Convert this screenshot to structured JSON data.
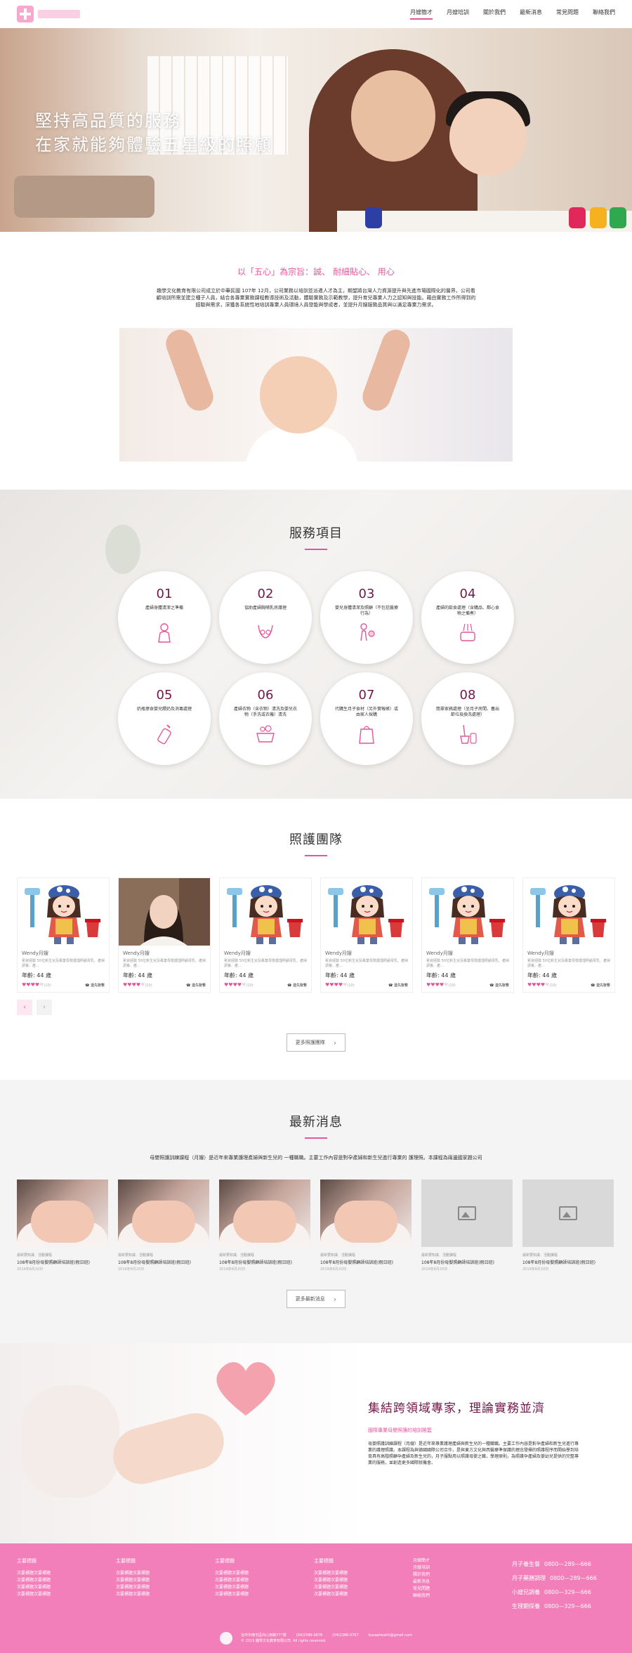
{
  "nav": {
    "items": [
      {
        "label": "月嫂簡才",
        "active": true
      },
      {
        "label": "月嫂培訓",
        "active": false
      },
      {
        "label": "關於我們",
        "active": false
      },
      {
        "label": "最新消息",
        "active": false
      },
      {
        "label": "常見問題",
        "active": false
      },
      {
        "label": "聯絡我們",
        "active": false
      }
    ]
  },
  "hero": {
    "line1": "堅持高品質的服務",
    "line2": "在家就能夠體驗五星級的照顧"
  },
  "intro": {
    "title": "以「五心」為宗旨：誠、 耐細貼心、 用心",
    "body": "趣學文化教育有限公司成立於中華民國 107年 12月，公司業務以培訓並派遣人才為主，期望將台灣人力資源提升與先進市場國際化的層界。公司看顧培訓所需並建立種子人員，結合各專業實務課程教導技術及活動，體驗實務及示範教學，提升育兒專業人力之認知與技能。藉由實務工作所得到的經驗與需求，深獲各系統性地培訓專業人員環境人員發能與學成者，並提升月嫂服務品質與以滿足專業力需求。"
  },
  "services": {
    "title": "服務項目",
    "items": [
      {
        "num": "01",
        "text": "產婦身體清潔之準備",
        "icon": "mother-icon"
      },
      {
        "num": "02",
        "text": "協助產婦胸哺乳房護理",
        "icon": "breast-care-icon"
      },
      {
        "num": "03",
        "text": "嬰兒身體清潔及照顧（不包括醫療行為）",
        "icon": "baby-care-icon"
      },
      {
        "num": "04",
        "text": "產婦的飲食處理（含購品、鄰心食物之備煮）",
        "icon": "food-icon"
      },
      {
        "num": "05",
        "text": "奶瓶擦食嬰兒餵奶及消毒處理",
        "icon": "bottle-icon"
      },
      {
        "num": "06",
        "text": "產婦衣物（含衣物）清洗及嬰兒衣物（手洗或衣機）清洗",
        "icon": "laundry-icon"
      },
      {
        "num": "07",
        "text": "代購生月子食材（另外實報帳）或由家人採購",
        "icon": "shopping-icon"
      },
      {
        "num": "08",
        "text": "簡單家務處理（坐月子房間、養出節垃圾換洗處理）",
        "icon": "cleaning-icon"
      }
    ]
  },
  "team": {
    "title": "照護團隊",
    "members": [
      {
        "name": "Wendy月嫂",
        "desc": "累資經驗 50位新生兒及專業母嬰護理照顧母乳、產婦調養、產...",
        "age": "年齡: 44 歲",
        "rating": 4,
        "reviews": "(10)",
        "contact": "連先聯繫",
        "photo": "cartoon"
      },
      {
        "name": "Wendy月嫂",
        "desc": "累資經驗 50位新生兒及專業母嬰護理照顧母乳、產婦調養、產...",
        "age": "年齡: 44 歲",
        "rating": 4,
        "reviews": "(10)",
        "contact": "連先聯繫",
        "photo": "real"
      },
      {
        "name": "Wendy月嫂",
        "desc": "累資經驗 50位新生兒及專業母嬰護理照顧母乳、產婦調養、產...",
        "age": "年齡: 44 歲",
        "rating": 4,
        "reviews": "(10)",
        "contact": "連先聯繫",
        "photo": "cartoon"
      },
      {
        "name": "Wendy月嫂",
        "desc": "累資經驗 50位新生兒及專業母嬰護理照顧母乳、產婦調養、產...",
        "age": "年齡: 44 歲",
        "rating": 4,
        "reviews": "(10)",
        "contact": "連先聯繫",
        "photo": "cartoon"
      },
      {
        "name": "Wendy月嫂",
        "desc": "累資經驗 50位新生兒及專業母嬰護理照顧母乳、產婦調養、產...",
        "age": "年齡: 44 歲",
        "rating": 4,
        "reviews": "(10)",
        "contact": "連先聯繫",
        "photo": "cartoon"
      },
      {
        "name": "Wendy月嫂",
        "desc": "累資經驗 50位新生兒及專業母嬰護理照顧母乳、產婦調養、產...",
        "age": "年齡: 44 歲",
        "rating": 4,
        "reviews": "(10)",
        "contact": "連先聯繫",
        "photo": "cartoon"
      }
    ],
    "more_label": "更多照護團隊"
  },
  "news": {
    "title": "最新消息",
    "intro": "母嬰照護訓練課程（月嫂）是近年來專業護理產婦與新生兒的 一種職職。主要工作內容是對孕產婦和新生兒進行專業的 護理照。本課程為兩邊國家題公司",
    "items": [
      {
        "cat": "最新要知識．活動課程",
        "title": "108年8月份母嬰照顧師培訓班(假日班)",
        "date": "2019年8月20日",
        "image": "photo"
      },
      {
        "cat": "最新要知識．活動課程",
        "title": "108年8月份母嬰照顧師培訓班(假日班)",
        "date": "2019年8月20日",
        "image": "photo"
      },
      {
        "cat": "最新要知識．活動課程",
        "title": "108年8月份母嬰照顧師培訓班(假日班)",
        "date": "2019年8月20日",
        "image": "photo"
      },
      {
        "cat": "最新要知識．活動課程",
        "title": "108年8月份母嬰照顧師培訓班(假日班)",
        "date": "2019年8月20日",
        "image": "photo"
      },
      {
        "cat": "最新要知識．活動課程",
        "title": "108年8月份母嬰照顧師培訓班(假日班)",
        "date": "2019年8月20日",
        "image": "placeholder"
      },
      {
        "cat": "最新要知識．活動課程",
        "title": "108年8月份母嬰照顧師培訓班(假日班)",
        "date": "2019年8月20日",
        "image": "placeholder"
      }
    ],
    "more_label": "更多最新消息"
  },
  "expert": {
    "title": "集結跨領域專家，理論實務並濟",
    "subtitle": "國際專業母嬰照護的培訓搖籃",
    "body": "母嬰照護訓練課程（月嫂）是近年來專業護理產婦與新生兒的一種職職。主要工作內容是對孕產婦和新生兒進行專業的護理照護。本課程為與德國國際公司合作，是與東方文化與西醫療準保護的理念發揮的照護程序而開始學到培育具有高階照顧孕產婦及新生兒的，月子服點用以照護母嬰之職，學理原則，為照護孕產婦及嬰幼兒提供的完整專業的服務，並創造更多國際就機會。"
  },
  "footer": {
    "columns": [
      {
        "head": "主要標題",
        "links": [
          "次要標題次要標題",
          "次要標題次要標題",
          "次要標題次要標題",
          "次要標題次要標題"
        ]
      },
      {
        "head": "主要標題",
        "links": [
          "次要標題次要標題",
          "次要標題次要標題",
          "次要標題次要標題",
          "次要標題次要標題"
        ]
      },
      {
        "head": "主要標題",
        "links": [
          "次要標題次要標題",
          "次要標題次要標題",
          "次要標題次要標題",
          "次要標題次要標題"
        ]
      },
      {
        "head": "主要標題",
        "links": [
          "次要標題次要標題",
          "次要標題次要標題",
          "次要標題次要標題",
          "次要標題次要標題"
        ]
      }
    ],
    "site_links": [
      "月嫂簡才",
      "月嫂培訓",
      "關於我們",
      "最新消息",
      "常見問題",
      "聯絡我們"
    ],
    "phones": [
      {
        "label": "月子養生餐",
        "number": "0800—289—666"
      },
      {
        "label": "月子藥膳調理",
        "number": "0800—289—666"
      },
      {
        "label": "小嫂兄調養",
        "number": "0800—329—666"
      },
      {
        "label": "生理期保養",
        "number": "0800—329—666"
      }
    ],
    "address": "台中市南屯區向心南路777號",
    "tel": "(04)2386-0878",
    "fax": "(04)2386-0767",
    "email": "busaehealth@gmail.com",
    "copyright": "© 2019 趣學文化教育有限公司. All rights reserved."
  },
  "colors": {
    "accent": "#e2579a",
    "deep": "#73174a",
    "footer": "#f27fb9"
  }
}
